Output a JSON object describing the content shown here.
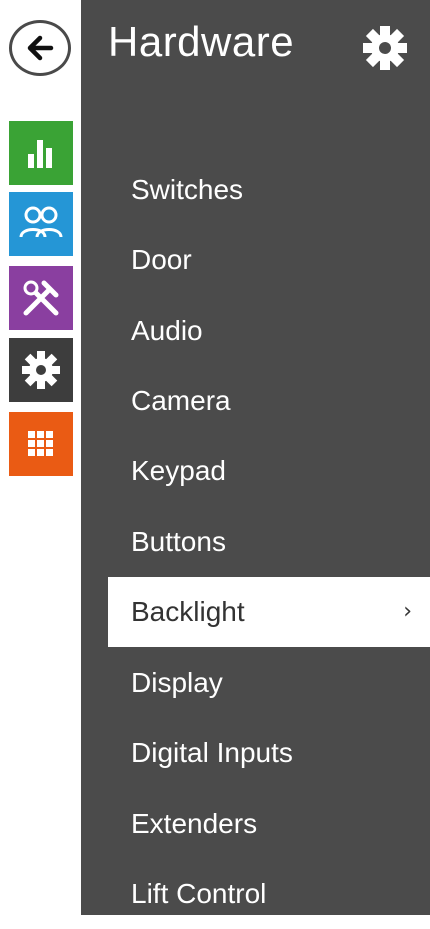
{
  "header": {
    "title": "Hardware"
  },
  "rail": {
    "items": [
      {
        "icon": "chart-icon",
        "color": "#3aa335"
      },
      {
        "icon": "users-icon",
        "color": "#2596d6"
      },
      {
        "icon": "tools-icon",
        "color": "#8a3fa0"
      },
      {
        "icon": "gear-icon",
        "color": "#3d3d3d"
      },
      {
        "icon": "grid-icon",
        "color": "#ea5b14"
      }
    ]
  },
  "menu": {
    "items": [
      {
        "label": "Switches"
      },
      {
        "label": "Door"
      },
      {
        "label": "Audio"
      },
      {
        "label": "Camera"
      },
      {
        "label": "Keypad"
      },
      {
        "label": "Buttons"
      },
      {
        "label": "Backlight",
        "active": true,
        "chevron": "›"
      },
      {
        "label": "Display"
      },
      {
        "label": "Digital Inputs"
      },
      {
        "label": "Extenders"
      },
      {
        "label": "Lift Control"
      }
    ]
  },
  "colors": {
    "panel": "#4b4b4b",
    "active_bg": "#ffffff"
  }
}
